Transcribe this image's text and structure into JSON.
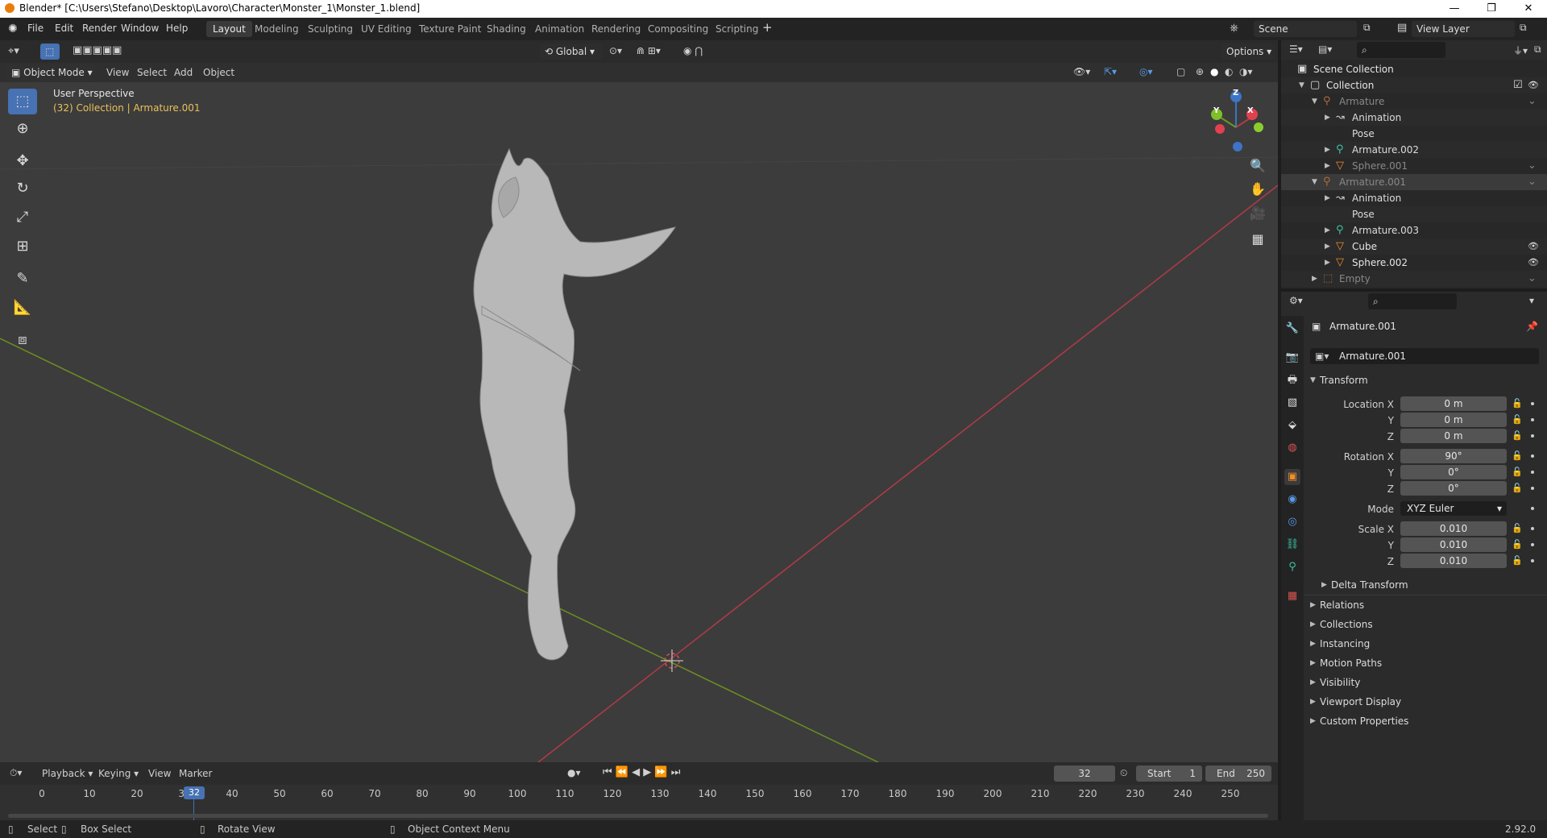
{
  "window": {
    "title": "Blender* [C:\\Users\\Stefano\\Desktop\\Lavoro\\Character\\Monster_1\\Monster_1.blend]"
  },
  "menu": [
    "File",
    "Edit",
    "Render",
    "Window",
    "Help"
  ],
  "workspaces": [
    "Layout",
    "Modeling",
    "Sculpting",
    "UV Editing",
    "Texture Paint",
    "Shading",
    "Animation",
    "Rendering",
    "Compositing",
    "Scripting"
  ],
  "scene": {
    "name": "Scene",
    "view_layer": "View Layer"
  },
  "viewport": {
    "mode": "Object Mode",
    "header_menus": [
      "View",
      "Select",
      "Add",
      "Object"
    ],
    "orientation": "Global",
    "options": "Options",
    "overlay_title": "User Perspective",
    "overlay_sub": "(32) Collection | Armature.001",
    "gizmo": {
      "x": "X",
      "y": "Y",
      "z": "Z"
    }
  },
  "outliner": {
    "rows": [
      {
        "label": "Scene Collection",
        "icon": "scene-collection-icon"
      },
      {
        "label": "Collection",
        "icon": "collection-icon"
      },
      {
        "label": "Armature",
        "icon": "armature-icon"
      },
      {
        "label": "Animation",
        "icon": "animation-icon"
      },
      {
        "label": "Pose",
        "icon": "pose-icon"
      },
      {
        "label": "Armature.002",
        "icon": "armature-icon"
      },
      {
        "label": "Sphere.001",
        "icon": "mesh-icon"
      },
      {
        "label": "Armature.001",
        "icon": "armature-icon"
      },
      {
        "label": "Animation",
        "icon": "animation-icon"
      },
      {
        "label": "Pose",
        "icon": "pose-icon"
      },
      {
        "label": "Armature.003",
        "icon": "armature-icon"
      },
      {
        "label": "Cube",
        "icon": "mesh-icon"
      },
      {
        "label": "Sphere.002",
        "icon": "mesh-icon"
      },
      {
        "label": "Empty",
        "icon": "empty-icon"
      }
    ]
  },
  "properties": {
    "object_name": "Armature.001",
    "datablock": "Armature.001",
    "transform_title": "Transform",
    "location": {
      "label_x": "Location X",
      "x": "0 m",
      "y": "0 m",
      "z": "0 m"
    },
    "rotation": {
      "label_x": "Rotation X",
      "x": "90°",
      "y": "0°",
      "z": "0°"
    },
    "mode": {
      "label": "Mode",
      "value": "XYZ Euler"
    },
    "scale": {
      "label_x": "Scale X",
      "x": "0.010",
      "y": "0.010",
      "z": "0.010"
    },
    "axis_y": "Y",
    "axis_z": "Z",
    "panels": [
      "Delta Transform",
      "Relations",
      "Collections",
      "Instancing",
      "Motion Paths",
      "Visibility",
      "Viewport Display",
      "Custom Properties"
    ]
  },
  "timeline": {
    "menus": [
      "Playback",
      "Keying",
      "View",
      "Marker"
    ],
    "current_frame": "32",
    "start_label": "Start",
    "start": "1",
    "end_label": "End",
    "end": "250",
    "ticks": [
      "0",
      "10",
      "20",
      "30",
      "40",
      "50",
      "60",
      "70",
      "80",
      "90",
      "100",
      "110",
      "120",
      "130",
      "140",
      "150",
      "160",
      "170",
      "180",
      "190",
      "200",
      "210",
      "220",
      "230",
      "240",
      "250"
    ],
    "frame_marker": "32"
  },
  "statusbar": {
    "select": "Select",
    "box_select": "Box Select",
    "rotate_view": "Rotate View",
    "context_menu": "Object Context Menu",
    "version": "2.92.0"
  }
}
